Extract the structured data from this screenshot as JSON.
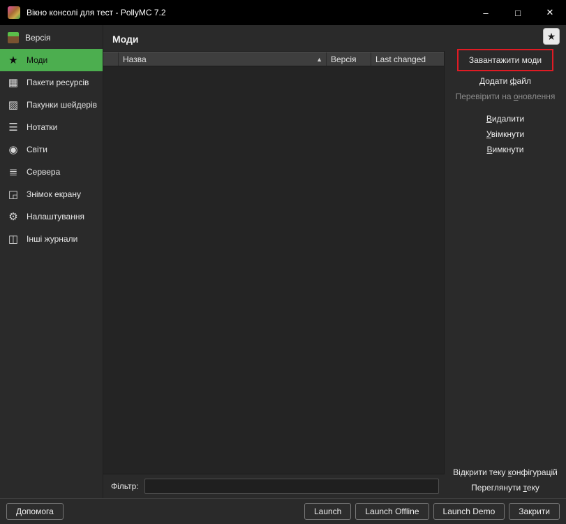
{
  "window": {
    "title": "Вікно консолі для тест - PollyMC 7.2",
    "minimize_glyph": "–",
    "maximize_glyph": "□",
    "close_glyph": "✕"
  },
  "colors": {
    "selection_green": "#4cae4f",
    "annotation_red": "#e01b24",
    "titlebar_black": "#000000"
  },
  "icons": {
    "star": "★",
    "resource_pack": "▦",
    "shader_pack": "▨",
    "notes": "☰",
    "worlds": "◉",
    "servers": "≣",
    "screenshot": "◲",
    "settings": "⚙",
    "logs": "◫",
    "sort_asc": "▲",
    "favorite_star": "★"
  },
  "sidebar": {
    "items": [
      {
        "label": "Версія"
      },
      {
        "label": "Моди",
        "selected": true
      },
      {
        "label": "Пакети ресурсів"
      },
      {
        "label": "Пакунки шейдерів"
      },
      {
        "label": "Нотатки"
      },
      {
        "label": "Світи"
      },
      {
        "label": "Сервера"
      },
      {
        "label": "Знімок екрану"
      },
      {
        "label": "Налаштування"
      },
      {
        "label": "Інші журнали"
      }
    ]
  },
  "main": {
    "title": "Моди",
    "table": {
      "col_name": "Назва",
      "col_version": "Версія",
      "col_changed": "Last changed",
      "rows": []
    },
    "filter_label": "Фільтр:",
    "filter_value": ""
  },
  "actions": {
    "download_mods": {
      "label": "Завантажити моди"
    },
    "add_file": {
      "pre": "Додати ",
      "u": "ф",
      "post": "айл"
    },
    "check_updates": {
      "pre": "Перевірити на ",
      "u": "о",
      "post": "новлення",
      "disabled": true
    },
    "delete": {
      "pre": "",
      "u": "В",
      "post": "идалити"
    },
    "enable": {
      "pre": "",
      "u": "У",
      "post": "вімкнути"
    },
    "disable": {
      "pre": "",
      "u": "В",
      "post": "имкнути"
    },
    "open_config": {
      "pre": "Відкрити теку ",
      "u": "к",
      "post": "онфігурацій"
    },
    "view_folder": {
      "pre": "Переглянути ",
      "u": "т",
      "post": "еку"
    }
  },
  "footer": {
    "help": "Допомога",
    "launch": "Launch",
    "launch_offline": "Launch Offline",
    "launch_demo": "Launch Demo",
    "close": "Закрити"
  }
}
